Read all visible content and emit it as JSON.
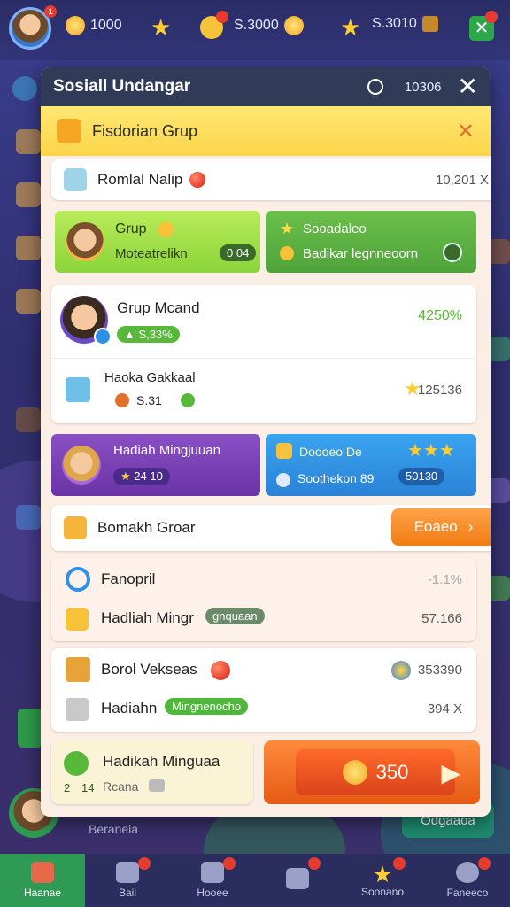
{
  "topbar": {
    "avatar_badge": "1",
    "coins": "1000",
    "resource_2": "S.3000",
    "resource_3": "S.3010"
  },
  "modal": {
    "title": "Sosiall Undangar",
    "header_count": "10306",
    "close": "✕"
  },
  "subheader": {
    "title": "Fisdorian Grup",
    "close": "✕"
  },
  "row1": {
    "label": "Romlal Nalip",
    "value": "10,201 X"
  },
  "tiles_top": {
    "left": {
      "title": "Grup",
      "sub": "Moteatrelikn",
      "pill": "0 04"
    },
    "right": {
      "title": "Sooadaleo",
      "sub": "Badikar legnneoorn"
    }
  },
  "group_card": {
    "name": "Grup Mcand",
    "percent": "4250%",
    "pill": "S,33%",
    "item_title": "Haoka Gakkaal",
    "item_sub": "S.31",
    "item_value": "125136"
  },
  "tiles_mid": {
    "left": {
      "title": "Hadiah Mingjuuan",
      "pill": "24 10"
    },
    "right": {
      "title": "Doooeo De",
      "sub": "Soothekon 89",
      "pill": "50130"
    }
  },
  "row_bomakh": {
    "label": "Bomakh Groar",
    "button": "Eoaeo"
  },
  "card_fanopril": {
    "r1_label": "Fanopril",
    "r1_value": "-1.1%",
    "r2_label": "Hadliah Mingr",
    "r2_badge": "gnquaan",
    "r2_value": "57.166"
  },
  "card_borol": {
    "r1_label": "Borol Vekseas",
    "r1_value": "353390",
    "r2_label": "Hadiahn",
    "r2_badge": "Mingnenocho",
    "r2_value": "394 X"
  },
  "bottom_tile": {
    "title": "Hadikah Minguaa",
    "sub": "Rcana",
    "count": "14",
    "count_prefix": "2"
  },
  "claim_button": {
    "value": "350"
  },
  "nav": [
    {
      "label": "Haanae",
      "icon": "home-icon"
    },
    {
      "label": "Bail",
      "icon": "mail-icon"
    },
    {
      "label": "Hooee",
      "icon": "pin-icon"
    },
    {
      "label": "",
      "icon": "chat-icon"
    },
    {
      "label": "Soonano",
      "icon": "star-icon"
    },
    {
      "label": "Faneeco",
      "icon": "smile-icon"
    }
  ],
  "bg_labels": {
    "behind_left": "Beraneia",
    "behind_right": "Odgaaoa"
  },
  "colors": {
    "accent_green": "#8bd43a",
    "accent_purple": "#7a3fb0",
    "accent_blue": "#2e8fe6",
    "accent_orange": "#f07c12"
  }
}
